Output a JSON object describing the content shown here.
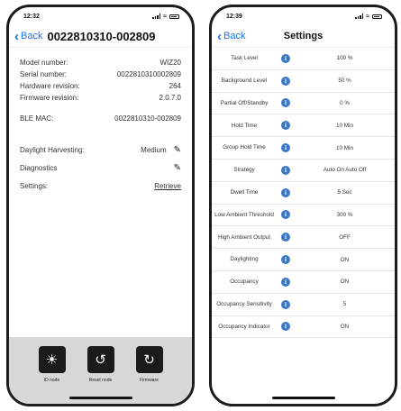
{
  "left_phone": {
    "status_time": "12:32",
    "back_label": "Back",
    "title": "0022810310-002809",
    "info_rows": [
      {
        "label": "Model number:",
        "value": "WIZ20"
      },
      {
        "label": "Serial number:",
        "value": "0022810310002809"
      },
      {
        "label": "Hardware revision:",
        "value": "264"
      },
      {
        "label": "Firmware revision:",
        "value": "2.0.7.0"
      }
    ],
    "ble_mac": {
      "label": "BLE MAC:",
      "value": "0022810310-002809"
    },
    "daylight_harvesting": {
      "label": "Daylight Harvesting:",
      "value": "Medium"
    },
    "diagnostics": {
      "label": "Diagnostics"
    },
    "settings": {
      "label": "Settings:",
      "link": "Retrieve"
    },
    "toolbar": [
      {
        "label": "ID node",
        "icon": "sun-icon"
      },
      {
        "label": "Reset node",
        "icon": "reset-icon"
      },
      {
        "label": "Firmware",
        "icon": "firmware-icon"
      }
    ]
  },
  "right_phone": {
    "status_time": "12:39",
    "back_label": "Back",
    "title": "Settings",
    "settings": [
      {
        "label": "Task Level",
        "value": "100 %"
      },
      {
        "label": "Background Level",
        "value": "50 %"
      },
      {
        "label": "Partial Off/Standby",
        "value": "0 %"
      },
      {
        "label": "Hold Time",
        "value": "10 Min"
      },
      {
        "label": "Group Hold Time",
        "value": "10 Min"
      },
      {
        "label": "Strategy",
        "value": "Auto On Auto Off"
      },
      {
        "label": "Dwell Time",
        "value": "5 Sec"
      },
      {
        "label": "Low Ambient Threshold",
        "value": "300 %"
      },
      {
        "label": "High Ambient Output",
        "value": "OFF"
      },
      {
        "label": "Daylighting",
        "value": "ON"
      },
      {
        "label": "Occupancy",
        "value": "ON"
      },
      {
        "label": "Occupancy Sensitivity",
        "value": "5"
      },
      {
        "label": "Occupancy Indicator",
        "value": "ON"
      }
    ]
  },
  "colors": {
    "accent": "#1a73e8",
    "info_icon": "#3a79c6",
    "toolbar_bg": "#d7d7d7"
  }
}
